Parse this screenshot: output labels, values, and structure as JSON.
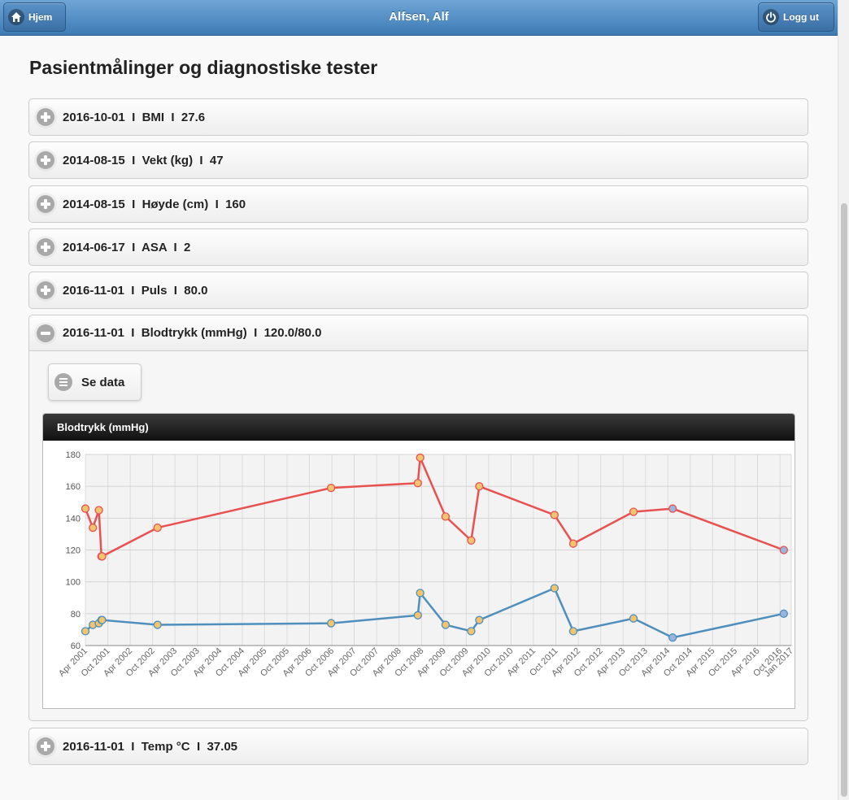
{
  "header": {
    "title": "Alfsen, Alf",
    "home_label": "Hjem",
    "logout_label": "Logg ut"
  },
  "page": {
    "title": "Pasientmålinger og diagnostiske tester"
  },
  "measurements": [
    {
      "label": "2016-10-01  I  BMI  I  27.6",
      "expanded": false
    },
    {
      "label": "2014-08-15  I  Vekt (kg)  I  47",
      "expanded": false
    },
    {
      "label": "2014-08-15  I  Høyde (cm)  I  160",
      "expanded": false
    },
    {
      "label": "2014-06-17  I  ASA  I  2",
      "expanded": false
    },
    {
      "label": "2016-11-01  I  Puls  I  80.0",
      "expanded": false
    },
    {
      "label": "2016-11-01  I  Blodtrykk (mmHg)  I  120.0/80.0",
      "expanded": true
    },
    {
      "label": "2016-11-01  I  Temp °C  I  37.05",
      "expanded": false
    }
  ],
  "expanded_panel": {
    "button_label": "Se data",
    "chart_title": "Blodtrykk (mmHg)"
  },
  "colors": {
    "header": "#4a86c0",
    "systolic": "#e8514f",
    "diastolic": "#4f8fbd",
    "marker": "#f2c46d",
    "marker_latest": "#9bb4dd"
  },
  "chart_data": {
    "type": "line",
    "title": "",
    "xlabel": "",
    "ylabel": "",
    "ylim": [
      60,
      180
    ],
    "yticks": [
      60,
      80,
      100,
      120,
      140,
      160,
      180
    ],
    "xticks": [
      "Apr 2001",
      "Oct 2001",
      "Apr 2002",
      "Oct 2002",
      "Apr 2003",
      "Oct 2003",
      "Apr 2004",
      "Oct 2004",
      "Apr 2005",
      "Oct 2005",
      "Apr 2006",
      "Oct 2006",
      "Apr 2007",
      "Oct 2007",
      "Apr 2008",
      "Oct 2008",
      "Apr 2009",
      "Oct 2009",
      "Apr 2010",
      "Oct 2010",
      "Apr 2011",
      "Oct 2011",
      "Apr 2012",
      "Oct 2012",
      "Apr 2013",
      "Oct 2013",
      "Apr 2014",
      "Oct 2014",
      "Apr 2015",
      "Oct 2015",
      "Apr 2016",
      "Oct 2016",
      "Jan 2017"
    ],
    "x": [
      "2001-04-01",
      "2001-06-01",
      "2001-07-20",
      "2001-08-10",
      "2001-08-15",
      "2002-11-10",
      "2006-09-25",
      "2008-09-01",
      "2008-09-20",
      "2009-04-15",
      "2009-11-10",
      "2010-01-15",
      "2011-09-20",
      "2012-02-20",
      "2013-06-25",
      "2014-05-10",
      "2016-11-01"
    ],
    "series": [
      {
        "values": [
          146,
          134,
          145,
          116,
          116,
          134,
          159,
          162,
          178,
          141,
          126,
          160,
          142,
          124,
          144,
          146,
          120
        ]
      },
      {
        "values": [
          69,
          73,
          74,
          76,
          76,
          73,
          74,
          79,
          93,
          73,
          69,
          76,
          96,
          69,
          77,
          65,
          80
        ]
      }
    ],
    "grid": true,
    "legend": "none"
  }
}
